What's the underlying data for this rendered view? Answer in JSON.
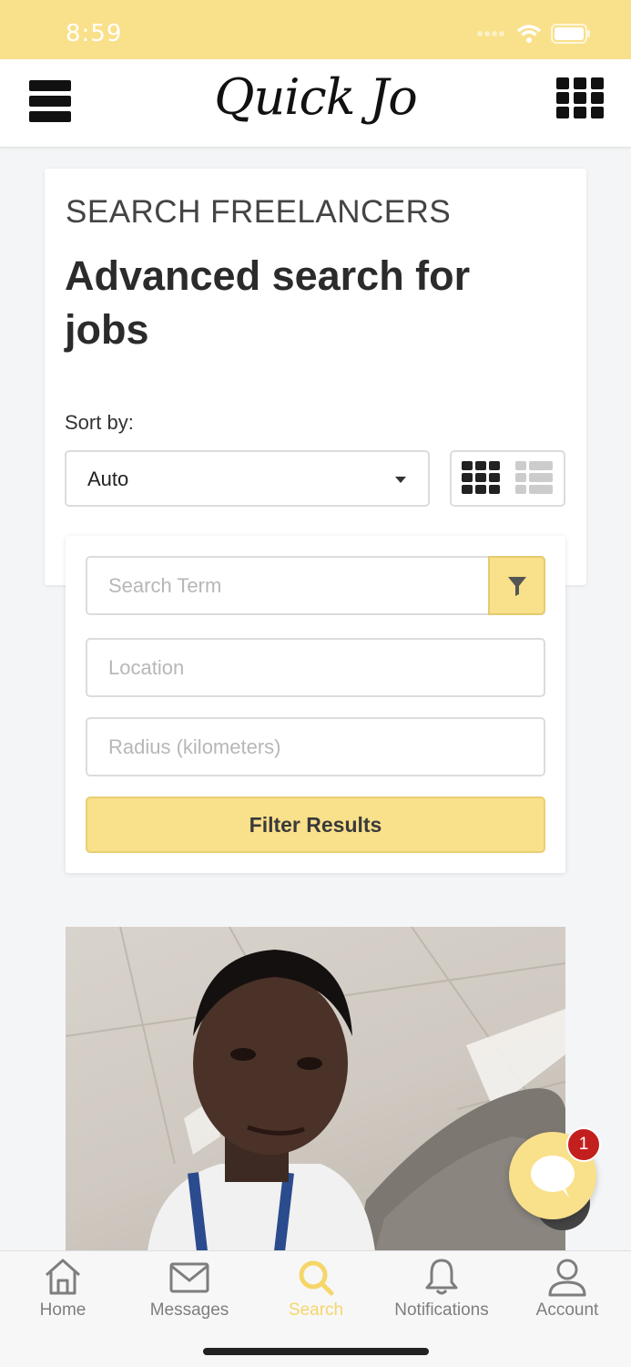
{
  "status_bar": {
    "time": "8:59",
    "icons": [
      "signal-icon",
      "wifi-icon",
      "battery-icon"
    ]
  },
  "header": {
    "logo_text": "Quick Jo",
    "menu_icon": "hamburger-menu-icon",
    "apps_icon": "grid-menu-icon"
  },
  "search_card": {
    "eyebrow": "SEARCH FREELANCERS",
    "title": "Advanced search for jobs",
    "sort_label": "Sort by:",
    "sort_value": "Auto"
  },
  "filters": {
    "search_placeholder": "Search Term",
    "location_placeholder": "Location",
    "radius_placeholder": "Radius (kilometers)",
    "filter_button": "Filter Results"
  },
  "chat": {
    "badge_count": "1"
  },
  "bottom_nav": {
    "items": [
      {
        "label": "Home",
        "icon": "home-icon"
      },
      {
        "label": "Messages",
        "icon": "envelope-icon"
      },
      {
        "label": "Search",
        "icon": "search-icon",
        "active": true
      },
      {
        "label": "Notifications",
        "icon": "bell-icon"
      },
      {
        "label": "Account",
        "icon": "user-icon"
      }
    ]
  },
  "colors": {
    "accent": "#f9e08a",
    "active_nav": "#f6d66a",
    "badge": "#c41f1f"
  }
}
